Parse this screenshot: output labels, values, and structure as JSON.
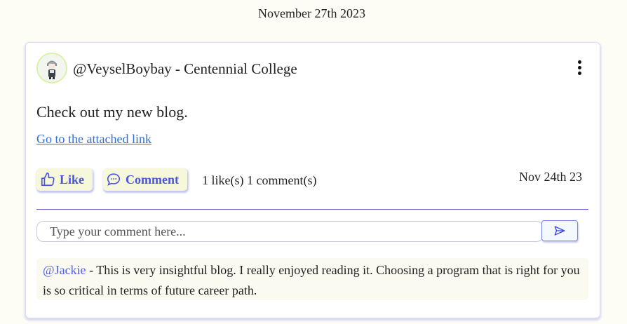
{
  "feed": {
    "date_header": "November 27th 2023"
  },
  "post": {
    "author": "@VeyselBoybay - Centennial College",
    "text": "Check out my new blog.",
    "link_text": "Go to the attached link",
    "like_label": "Like",
    "comment_label": "Comment",
    "counts": "1 like(s) 1 comment(s)",
    "date": "Nov 24th 23",
    "menu_icon": "more-vertical-icon",
    "like_icon": "thumbs-up-icon",
    "comment_icon": "chat-bubble-icon"
  },
  "comment_form": {
    "placeholder": "Type your comment here...",
    "send_icon": "send-icon"
  },
  "comments": [
    {
      "user": "@Jackie",
      "separator": " - ",
      "text": "This is very insightful blog. I really enjoyed reading it. Choosing a program that is right for you is so critical in terms of future career path."
    }
  ],
  "colors": {
    "accent": "#4a55e0",
    "link": "#2f6fd6",
    "button_bg": "#f7f7dc",
    "page_bg": "#fdfdf5",
    "avatar_ring": "#d8f2a8"
  }
}
